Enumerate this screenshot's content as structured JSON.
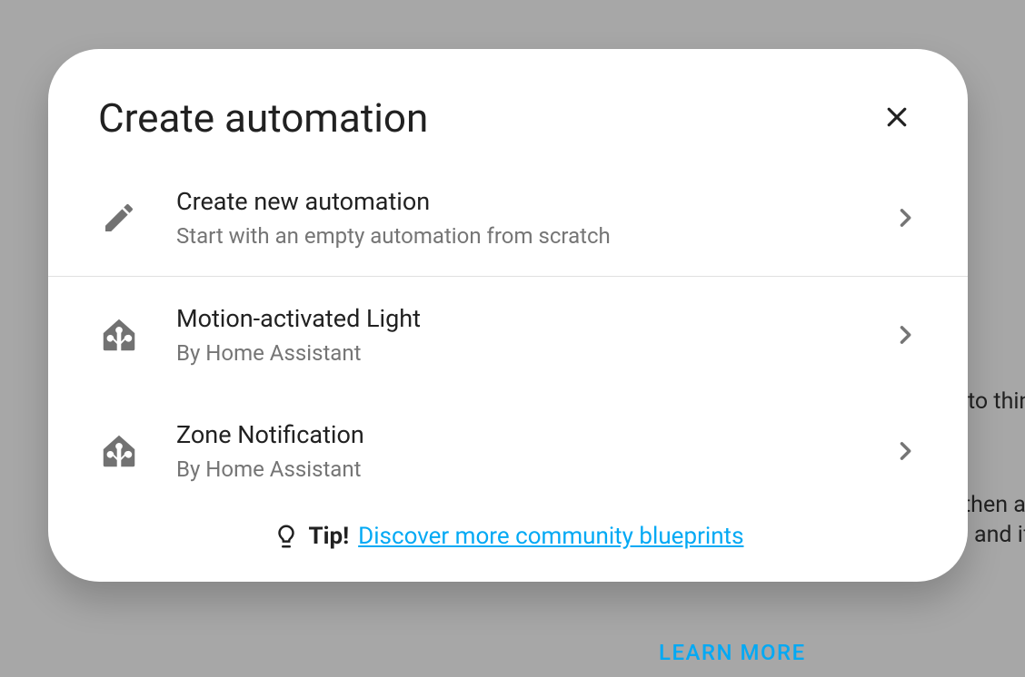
{
  "background": {
    "text_1": "to thin",
    "text_2": "then a",
    "text_3": "and if",
    "learn_more": "LEARN MORE"
  },
  "dialog": {
    "title": "Create automation",
    "options": [
      {
        "title": "Create new automation",
        "subtitle": "Start with an empty automation from scratch"
      },
      {
        "title": "Motion-activated Light",
        "subtitle": "By Home Assistant"
      },
      {
        "title": "Zone Notification",
        "subtitle": "By Home Assistant"
      }
    ],
    "tip": {
      "label": "Tip!",
      "link": "Discover more community blueprints"
    }
  }
}
